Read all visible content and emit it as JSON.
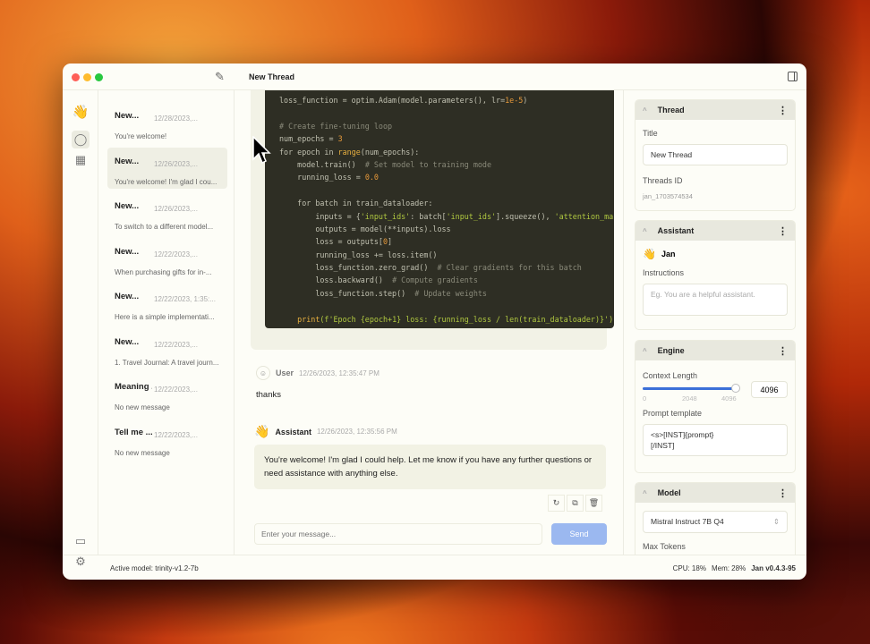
{
  "window": {
    "title": "New Thread"
  },
  "rail": {
    "icons": [
      "hand-wave-logo-icon",
      "chat-icon",
      "grid-icon",
      "monitor-icon",
      "gear-icon"
    ]
  },
  "threads": [
    {
      "title": "New...",
      "date": "12/28/2023,...",
      "preview": "You're welcome!"
    },
    {
      "title": "New...",
      "date": "12/26/2023,...",
      "preview": "You're welcome! I'm glad I cou..."
    },
    {
      "title": "New...",
      "date": "12/26/2023,...",
      "preview": "To switch to a different model..."
    },
    {
      "title": "New...",
      "date": "12/22/2023,...",
      "preview": "When purchasing gifts for in-..."
    },
    {
      "title": "New...",
      "date": "12/22/2023, 1:35:...",
      "preview": "Here is a simple implementati..."
    },
    {
      "title": "New...",
      "date": "12/22/2023,...",
      "preview": "1. Travel Journal: A travel journ..."
    },
    {
      "title": "Meaning ...",
      "date": "12/22/2023,...",
      "preview": "No new message"
    },
    {
      "title": "Tell me ...",
      "date": "12/22/2023,...",
      "preview": "No new message"
    }
  ],
  "code": [
    [
      [
        "loss_function = optim.Adam(model.parameters(), lr=",
        "k"
      ],
      [
        "1e-5",
        "n"
      ],
      [
        ")",
        "k"
      ]
    ],
    [],
    [
      [
        "# Create fine-tuning loop",
        "c"
      ]
    ],
    [
      [
        "num_epochs = ",
        "k"
      ],
      [
        "3",
        "n"
      ]
    ],
    [
      [
        "for epoch in ",
        "k"
      ],
      [
        "range",
        "f"
      ],
      [
        "(num_epochs):",
        "k"
      ]
    ],
    [
      [
        "    model.train()  ",
        "k"
      ],
      [
        "# Set model to training mode",
        "c"
      ]
    ],
    [
      [
        "    running_loss = ",
        "k"
      ],
      [
        "0.0",
        "n"
      ]
    ],
    [],
    [
      [
        "    for batch in train_dataloader:",
        "k"
      ]
    ],
    [
      [
        "        inputs = {",
        "k"
      ],
      [
        "'input_ids'",
        "s"
      ],
      [
        ": batch[",
        "k"
      ],
      [
        "'input_ids'",
        "s"
      ],
      [
        "].squeeze(), ",
        "k"
      ],
      [
        "'attention_mask'",
        "s"
      ]
    ],
    [
      [
        "        outputs = model(**inputs).loss",
        "k"
      ]
    ],
    [
      [
        "        loss = outputs[",
        "k"
      ],
      [
        "0",
        "n"
      ],
      [
        "]",
        "k"
      ]
    ],
    [
      [
        "        running_loss += loss.item()",
        "k"
      ]
    ],
    [
      [
        "        loss_function.zero_grad()  ",
        "k"
      ],
      [
        "# Clear gradients for this batch",
        "c"
      ]
    ],
    [
      [
        "        loss.backward()  ",
        "k"
      ],
      [
        "# Compute gradients",
        "c"
      ]
    ],
    [
      [
        "        loss_function.step()  ",
        "k"
      ],
      [
        "# Update weights",
        "c"
      ]
    ],
    [],
    [
      [
        "    print",
        "f"
      ],
      [
        "(f'Epoch {epoch+1} loss: {running_loss / len(train_dataloader)}')",
        "s"
      ]
    ]
  ],
  "messages": [
    {
      "author": "User",
      "time": "12/26/2023, 12:35:47 PM",
      "text": "thanks"
    },
    {
      "author": "Assistant",
      "time": "12/26/2023, 12:35:56 PM",
      "text": "You're welcome! I'm glad I could help. Let me know if you have any further questions or need assistance with anything else."
    }
  ],
  "composer": {
    "placeholder": "Enter your message...",
    "send": "Send"
  },
  "panel": {
    "thread": {
      "header": "Thread",
      "title_label": "Title",
      "title_value": "New Thread",
      "id_label": "Threads ID",
      "id_value": "jan_1703574534"
    },
    "assistant": {
      "header": "Assistant",
      "name": "Jan",
      "instructions_label": "Instructions",
      "instructions_placeholder": "Eg. You are a helpful assistant."
    },
    "engine": {
      "header": "Engine",
      "context_label": "Context Length",
      "context_value": "4096",
      "context_fraction": 1.0,
      "ticks": [
        "0",
        "2048",
        "4096"
      ],
      "prompt_label": "Prompt template",
      "prompt_value": "<s>[INST]{prompt}\n[/INST]"
    },
    "model": {
      "header": "Model",
      "selected": "Mistral Instruct 7B Q4",
      "max_tokens_label": "Max Tokens"
    }
  },
  "status": {
    "active_model": "Active model: trinity-v1.2-7b",
    "cpu": "CPU: 18%",
    "mem": "Mem: 28%",
    "version": "Jan v0.4.3-95"
  },
  "colors": {
    "accent": "#3b6fd8",
    "send_disabled": "#9bb8f0",
    "code_bg": "#2e2e24"
  }
}
